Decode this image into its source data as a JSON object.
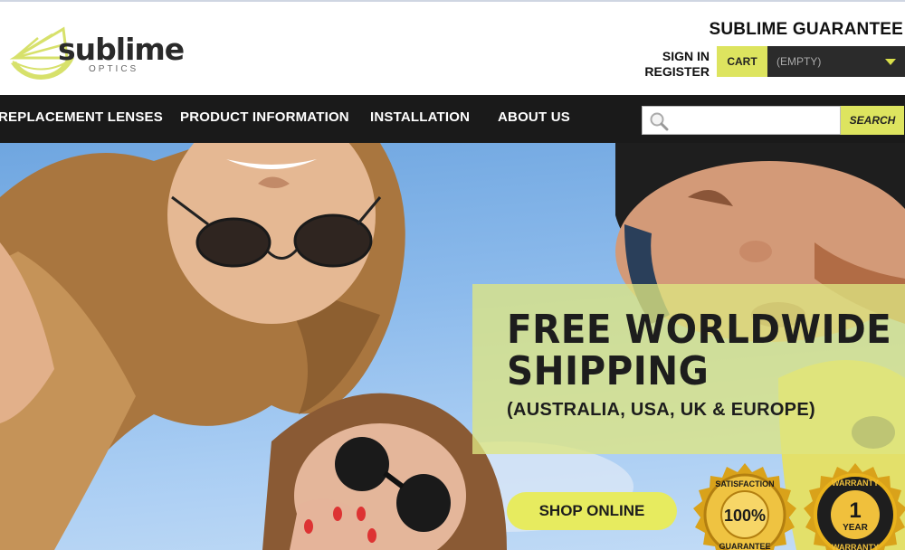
{
  "header": {
    "logo": {
      "word": "sublime",
      "sub": "OPTICS"
    },
    "guarantee_label": "SUBLIME GUARANTEE",
    "sign_in_label": "SIGN IN",
    "register_label": "REGISTER",
    "cart_label": "CART",
    "cart_status": "(EMPTY)"
  },
  "nav": {
    "items": [
      {
        "label": "REPLACEMENT LENSES"
      },
      {
        "label": "PRODUCT INFORMATION"
      },
      {
        "label": "INSTALLATION"
      },
      {
        "label": "ABOUT US"
      }
    ]
  },
  "search": {
    "value": "",
    "placeholder": "",
    "button_label": "SEARCH"
  },
  "hero": {
    "promo_line1": "FREE WORLDWIDE",
    "promo_line2": "SHIPPING",
    "promo_sub": "(AUSTRALIA, USA, UK & EUROPE)",
    "cta_label": "SHOP ONLINE",
    "badge_satisfaction": {
      "top": "SATISFACTION",
      "value": "100%",
      "bottom": "GUARANTEE"
    },
    "badge_warranty": {
      "top": "WARRANTY",
      "value": "1",
      "unit": "YEAR",
      "bottom": "WARRANTY"
    }
  },
  "colors": {
    "accent": "#dde45f",
    "nav_bg": "#1a1a1a",
    "promo_bg": "#dee682",
    "badge_gold": "#e9b21c"
  },
  "icons": [
    "lime-slice-logo-icon",
    "search-icon",
    "chevron-down-icon",
    "gold-seal-icon"
  ]
}
